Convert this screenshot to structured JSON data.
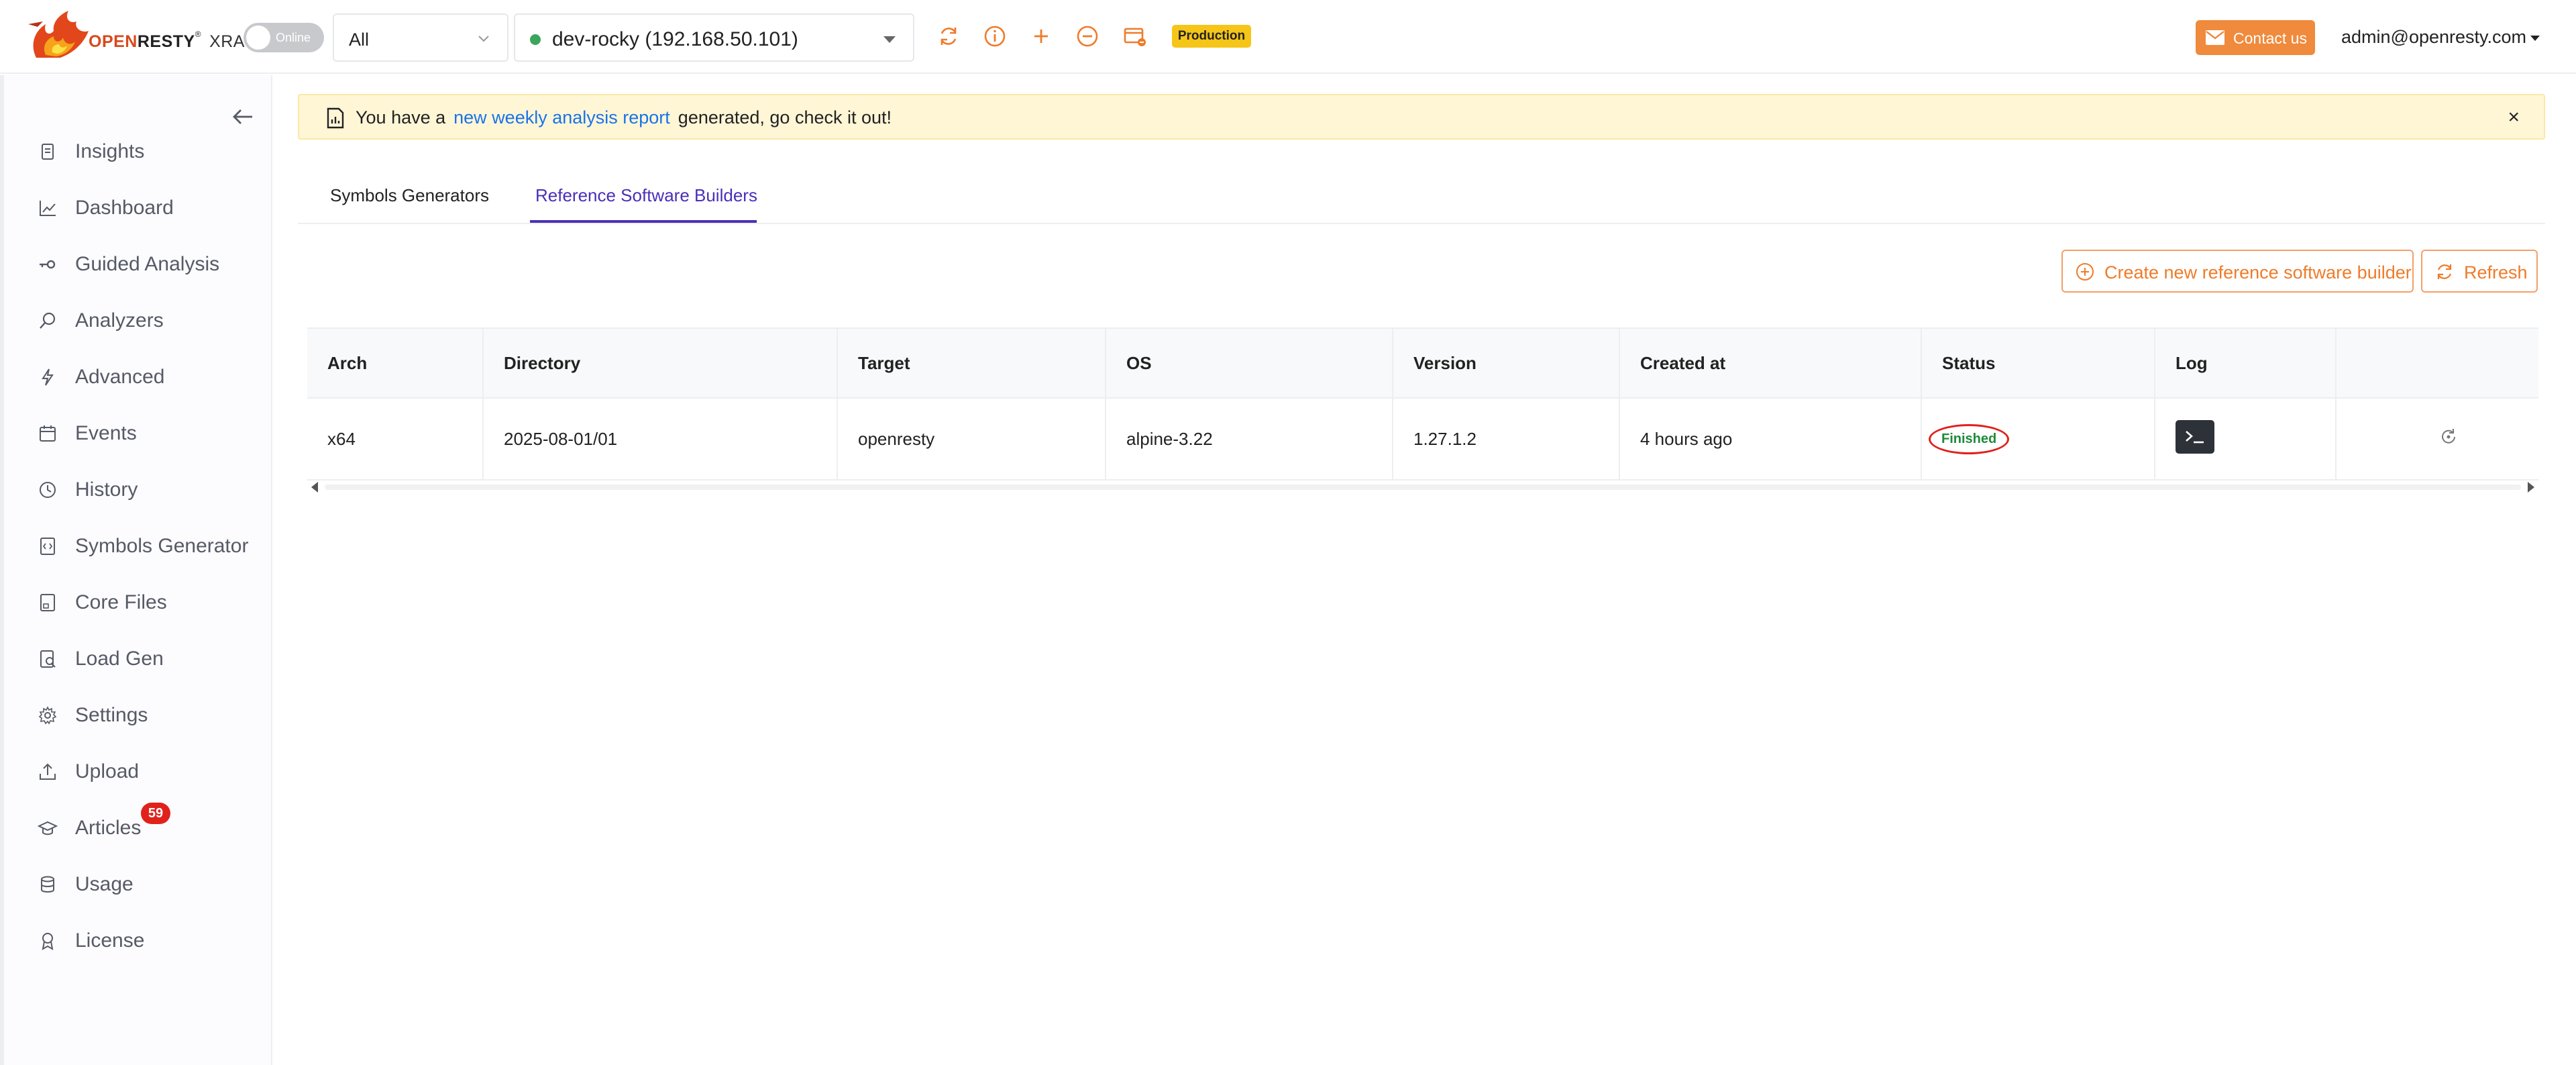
{
  "header": {
    "logo_open": "OPEN",
    "logo_resty": "RESTY",
    "logo_reg": "®",
    "logo_xray": "XRAY",
    "online_toggle_label": "Online",
    "scope_select": "All",
    "host_select": "dev-rocky (192.168.50.101)",
    "environment_badge": "Production",
    "contact_label": "Contact us",
    "user_email": "admin@openresty.com",
    "accent_color": "#f08a3c"
  },
  "sidebar": {
    "items": [
      {
        "label": "Insights",
        "icon": "document-icon"
      },
      {
        "label": "Dashboard",
        "icon": "chart-line-icon"
      },
      {
        "label": "Guided Analysis",
        "icon": "key-icon"
      },
      {
        "label": "Analyzers",
        "icon": "magnifier-icon"
      },
      {
        "label": "Advanced",
        "icon": "bolt-icon"
      },
      {
        "label": "Events",
        "icon": "calendar-icon"
      },
      {
        "label": "History",
        "icon": "clock-icon"
      },
      {
        "label": "Symbols Generator",
        "icon": "code-file-icon"
      },
      {
        "label": "Core Files",
        "icon": "core-file-icon"
      },
      {
        "label": "Load Gen",
        "icon": "load-gen-icon"
      },
      {
        "label": "Settings",
        "icon": "gear-icon"
      },
      {
        "label": "Upload",
        "icon": "upload-icon"
      },
      {
        "label": "Articles",
        "icon": "graduation-cap-icon",
        "badge": "59"
      },
      {
        "label": "Usage",
        "icon": "database-icon"
      },
      {
        "label": "License",
        "icon": "award-icon"
      }
    ]
  },
  "alert": {
    "prefix": "You have a",
    "link": "new weekly analysis report",
    "suffix": "generated, go check it out!",
    "close": "×"
  },
  "tabs": [
    {
      "label": "Symbols Generators",
      "active": false
    },
    {
      "label": "Reference Software Builders",
      "active": true
    }
  ],
  "actions": {
    "create_label": "Create new reference software builder",
    "refresh_label": "Refresh"
  },
  "table": {
    "columns": [
      "Arch",
      "Directory",
      "Target",
      "OS",
      "Version",
      "Created at",
      "Status",
      "Log",
      ""
    ],
    "rows": [
      {
        "arch": "x64",
        "directory": "2025-08-01/01",
        "target": "openresty",
        "os": "alpine-3.22",
        "version": "1.27.1.2",
        "created_at": "4 hours ago",
        "status": "Finished"
      }
    ]
  }
}
